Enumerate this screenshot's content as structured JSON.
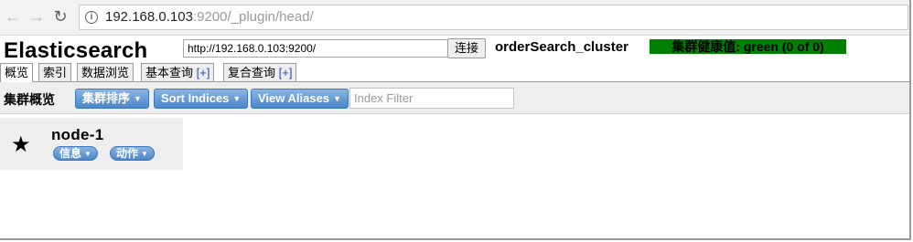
{
  "browser": {
    "url_host": "192.168.0.103",
    "url_rest": ":9200/_plugin/head/",
    "back_icon": "←",
    "forward_icon": "→",
    "reload_icon": "↻",
    "info_icon": "i"
  },
  "header": {
    "title": "Elasticsearch",
    "cluster_url": "http://192.168.0.103:9200/",
    "connect_label": "连接",
    "cluster_name": "orderSearch_cluster",
    "health_text": "集群健康值: green (0 of 0)",
    "health_color": "#008000"
  },
  "tabs": [
    {
      "label": "概览",
      "plus": ""
    },
    {
      "label": "索引",
      "plus": ""
    },
    {
      "label": "数据浏览",
      "plus": ""
    },
    {
      "label": "基本查询",
      "plus": "[+]"
    },
    {
      "label": "复合查询",
      "plus": "[+]"
    }
  ],
  "toolbar": {
    "title": "集群概览",
    "sort_cluster_label": "集群排序",
    "sort_indices_label": "Sort Indices",
    "view_aliases_label": "View Aliases",
    "index_filter_placeholder": "Index Filter",
    "caret": "▼"
  },
  "node": {
    "name": "node-1",
    "star_icon": "★",
    "info_label": "信息",
    "actions_label": "动作"
  },
  "colors": {
    "accent_blue": "#4b86c9",
    "health_green": "#008000"
  }
}
